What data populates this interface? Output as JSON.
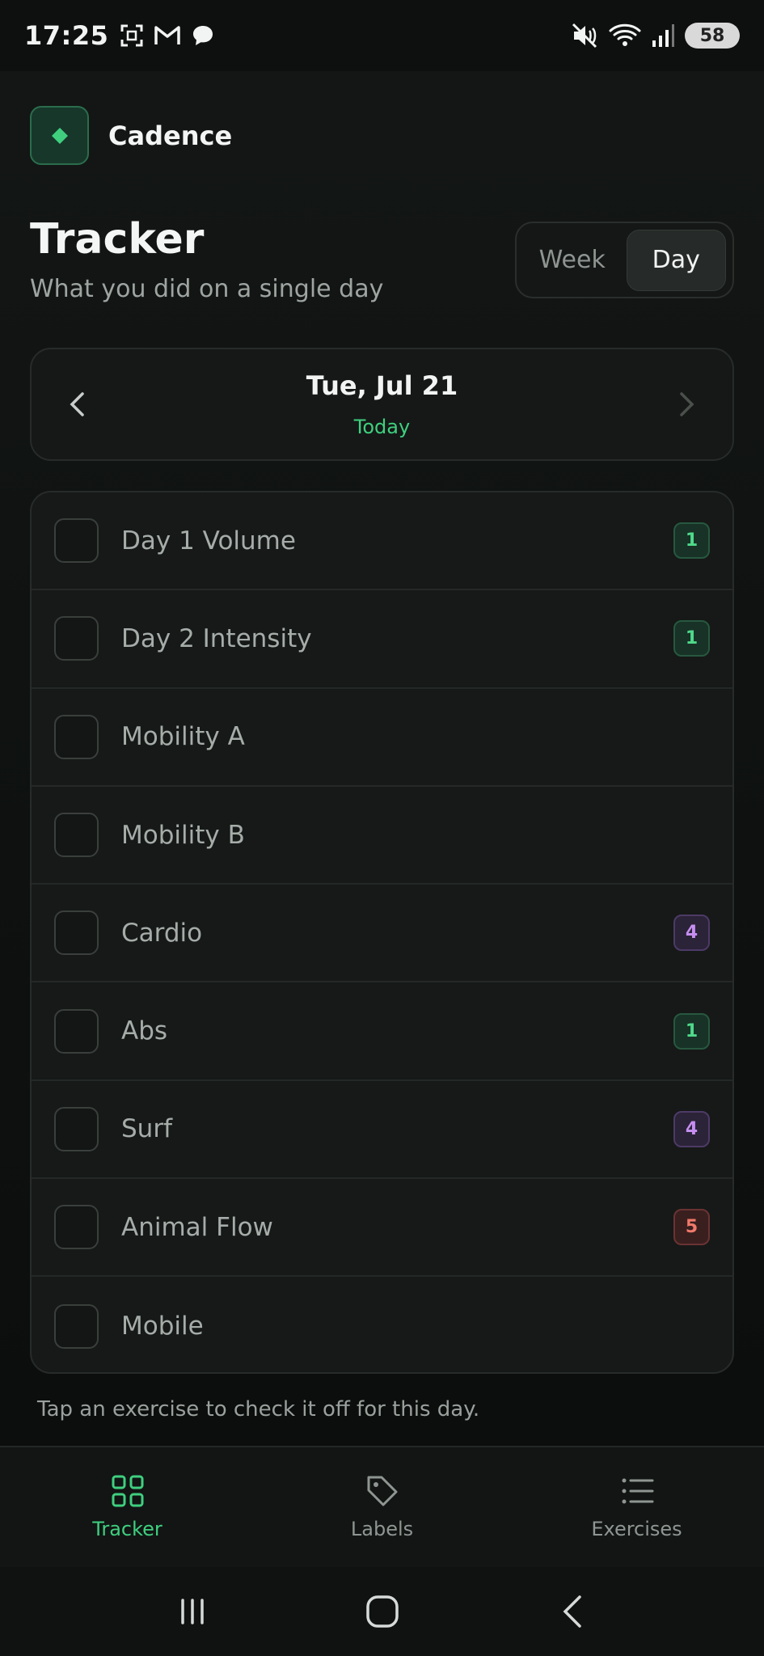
{
  "status_bar": {
    "time": "17:25",
    "left_icons": [
      "screenshot-icon",
      "gmail-icon",
      "chat-icon"
    ],
    "right_icons": [
      "mute-icon",
      "wifi-icon",
      "signal-icon"
    ],
    "battery": "58"
  },
  "brand": {
    "name": "Cadence",
    "accent": "#3fcf7f"
  },
  "header": {
    "title": "Tracker",
    "subtitle": "What you did on a single day",
    "view_toggle": {
      "options": [
        "Week",
        "Day"
      ],
      "selected": "Day"
    }
  },
  "date_nav": {
    "date": "Tue, Jul 21",
    "relative": "Today"
  },
  "exercises": [
    {
      "label": "Day 1 Volume",
      "badge": "1",
      "badge_color": "green"
    },
    {
      "label": "Day 2 Intensity",
      "badge": "1",
      "badge_color": "green"
    },
    {
      "label": "Mobility A",
      "badge": "",
      "badge_color": ""
    },
    {
      "label": "Mobility B",
      "badge": "",
      "badge_color": ""
    },
    {
      "label": "Cardio",
      "badge": "4",
      "badge_color": "purple"
    },
    {
      "label": "Abs",
      "badge": "1",
      "badge_color": "green"
    },
    {
      "label": "Surf",
      "badge": "4",
      "badge_color": "purple"
    },
    {
      "label": "Animal Flow",
      "badge": "5",
      "badge_color": "red"
    },
    {
      "label": "Mobile",
      "badge": "",
      "badge_color": ""
    }
  ],
  "hint": "Tap an exercise to check it off for this day.",
  "bottom_nav": {
    "items": [
      {
        "label": "Tracker",
        "icon": "grid-icon",
        "active": true
      },
      {
        "label": "Labels",
        "icon": "tag-icon",
        "active": false
      },
      {
        "label": "Exercises",
        "icon": "list-icon",
        "active": false
      }
    ]
  },
  "system_nav": [
    "recents-icon",
    "home-icon",
    "back-icon"
  ]
}
